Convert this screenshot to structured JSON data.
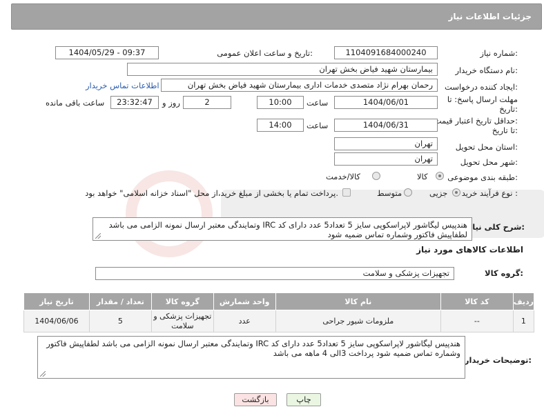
{
  "header": {
    "title": "جزئیات اطلاعات نیاز"
  },
  "form": {
    "need_number_label": "شماره نیاز:",
    "need_number_value": "1104091684000240",
    "announce_label": "تاریخ و ساعت اعلان عمومی:",
    "announce_value": "1404/05/29 - 09:37",
    "buyer_org_label": "نام دستگاه خریدار:",
    "buyer_org_value": "بیمارستان شهید فیاض بخش تهران",
    "creator_label": "ایجاد کننده درخواست:",
    "creator_value": "رحمان بهرام نژاد متصدی خدمات اداری بیمارستان شهید فیاض بخش تهران",
    "buyer_contact_link": "اطلاعات تماس خریدار",
    "reply_deadline_label_1": "مهلت ارسال پاسخ: تا",
    "reply_deadline_label_2": "تاریخ:",
    "reply_date": "1404/06/01",
    "time_label": "ساعت",
    "reply_time": "10:00",
    "days_value": "2",
    "days_label": "روز و",
    "remaining_value": "23:32:47",
    "remaining_label": "ساعت باقی مانده",
    "price_validity_label_1": "حداقل تاریخ اعتبار قیمت:",
    "price_validity_label_2": "تا تاریخ:",
    "validity_date": "1404/06/31",
    "validity_time": "14:00",
    "province_label": "استان محل تحویل:",
    "province_value": "تهران",
    "city_label": "شهر محل تحویل:",
    "city_value": "تهران",
    "category_label": "طبقه بندی موضوعی:",
    "category_options": [
      "کالا",
      "کالا/خدمت"
    ],
    "process_label": "نوع فرآیند خرید :",
    "process_options": [
      "جزیی",
      "متوسط"
    ],
    "payment_note": "پرداخت تمام یا بخشی از مبلغ خرید،از محل \"اسناد خزانه اسلامی\" خواهد بود.",
    "description_label": "شرح کلی نیاز:",
    "description_value": "هندپیس لیگاشور لاپراسکوپی سایز 5 تعداد5 عدد دارای کد IRC وتمایندگی معتبر ارسال نمونه الزامی می باشد لطفاپیش فاکتور وشماره تماس ضمیه شود"
  },
  "goods": {
    "section_title": "اطلاعات کالاهای مورد نیاز",
    "group_label": "گروه کالا:",
    "group_value": "تجهیزات پزشکی و سلامت",
    "columns": [
      "ردیف",
      "کد کالا",
      "نام کالا",
      "واحد شمارش",
      "گروه کالا",
      "تعداد / مقدار",
      "تاریخ نیاز"
    ],
    "rows": [
      {
        "row": "1",
        "code": "--",
        "name": "ملزومات شیور جراحی",
        "unit": "عدد",
        "group": "تجهیزات پزشکی و سلامت",
        "qty": "5",
        "date": "1404/06/06"
      }
    ]
  },
  "buyer_notes": {
    "label": "توضیحات خریدار:",
    "value": "هندپیس لیگاشور لاپراسکوپی سایز 5 تعداد5 عدد دارای کد IRC وتمایندگی معتبر ارسال نمونه الزامی می باشد لطفاپیش فاکتور وشماره تماس ضمیه شود پرداخت 3الی 4 ماهه می باشد"
  },
  "buttons": {
    "print": "چاپ",
    "back": "بازگشت"
  },
  "colors": {
    "header": "#a3a3a3",
    "table_header": "#a5a5a5",
    "link": "#2a5db0",
    "back_button": "#fbe3e3",
    "print_button": "#eaf6e2"
  }
}
